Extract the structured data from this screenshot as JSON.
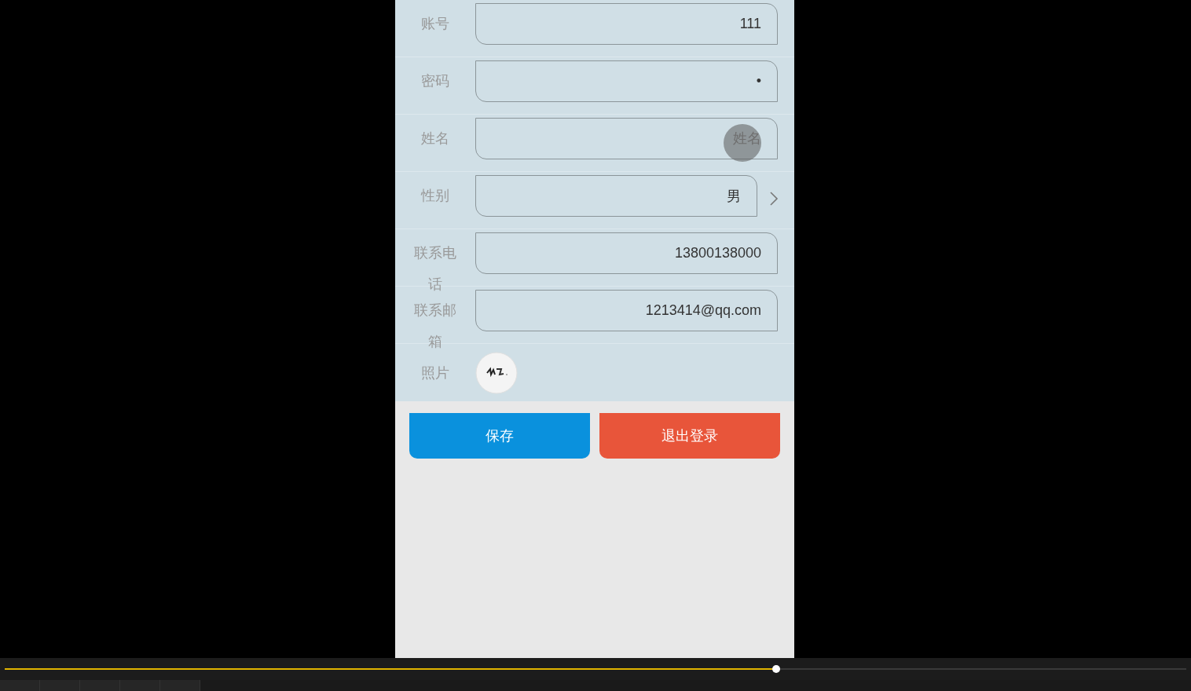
{
  "form": {
    "rows": [
      {
        "kind": "text",
        "label": "账号",
        "value": "111"
      },
      {
        "kind": "password",
        "label": "密码",
        "value": "•"
      },
      {
        "kind": "text",
        "label": "姓名",
        "placeholder": "姓名"
      },
      {
        "kind": "select",
        "label": "性别",
        "value": "男"
      },
      {
        "kind": "text",
        "label": "联系电话",
        "value": "13800138000"
      },
      {
        "kind": "text",
        "label": "联系邮箱",
        "value": "1213414@qq.com"
      },
      {
        "label": "照片"
      }
    ]
  },
  "buttons": [
    {
      "kind": "primary",
      "label": "保存"
    },
    {
      "kind": "danger",
      "label": "退出登录"
    }
  ],
  "player": {
    "level": 0.653
  }
}
